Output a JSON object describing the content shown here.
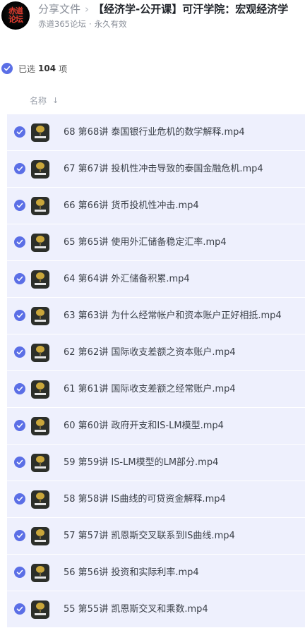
{
  "header": {
    "avatar_text": "赤道\n论坛",
    "breadcrumb_share": "分享文件",
    "breadcrumb_separator": "›",
    "title": "【经济学-公开课】可汗学院：宏观经济学",
    "source": "赤道365论坛",
    "validity": "永久有效"
  },
  "selection": {
    "label": "已选",
    "count": "104",
    "unit": "项"
  },
  "columns": {
    "name": "名称",
    "sort_icon": "↓"
  },
  "colors": {
    "accent": "#5b6fe6",
    "row_selected_bg": "#eef0fd"
  },
  "files": [
    {
      "name": "68 第68讲 泰国银行业危机的数学解释.mp4",
      "icon": "video-thumb-icon",
      "selected": true
    },
    {
      "name": "67 第67讲 投机性冲击导致的泰国金融危机.mp4",
      "icon": "video-thumb-icon",
      "selected": true
    },
    {
      "name": "66 第66讲 货币投机性冲击.mp4",
      "icon": "video-thumb-icon",
      "selected": true
    },
    {
      "name": "65 第65讲 使用外汇储备稳定汇率.mp4",
      "icon": "video-thumb-icon",
      "selected": true
    },
    {
      "name": "64 第64讲 外汇储备积累.mp4",
      "icon": "video-thumb-icon",
      "selected": true
    },
    {
      "name": "63 第63讲 为什么经常帐户和资本账户正好相抵.mp4",
      "icon": "video-thumb-icon",
      "selected": true
    },
    {
      "name": "62 第62讲 国际收支差额之资本账户.mp4",
      "icon": "video-thumb-icon",
      "selected": true
    },
    {
      "name": "61 第61讲 国际收支差额之经常账户.mp4",
      "icon": "video-thumb-icon",
      "selected": true
    },
    {
      "name": "60 第60讲 政府开支和IS-LM模型.mp4",
      "icon": "video-thumb-icon",
      "selected": true
    },
    {
      "name": "59 第59讲 IS-LM模型的LM部分.mp4",
      "icon": "video-thumb-icon",
      "selected": true
    },
    {
      "name": "58 第58讲 IS曲线的可贷资金解释.mp4",
      "icon": "video-thumb-icon",
      "selected": true
    },
    {
      "name": "57 第57讲 凯恩斯交叉联系到IS曲线.mp4",
      "icon": "video-thumb-icon",
      "selected": true
    },
    {
      "name": "56 第56讲 投资和实际利率.mp4",
      "icon": "video-thumb-icon",
      "selected": true
    },
    {
      "name": "55 第55讲 凯恩斯交叉和乘数.mp4",
      "icon": "video-thumb-icon",
      "selected": true
    }
  ]
}
